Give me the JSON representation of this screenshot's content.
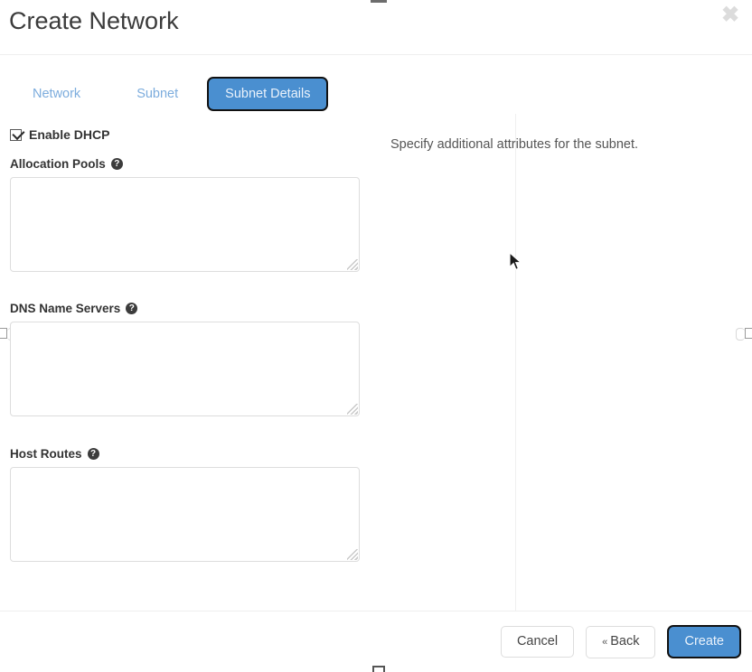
{
  "modal": {
    "title": "Create Network",
    "close_icon": "close-icon",
    "close_glyph": "✖"
  },
  "tabs": [
    {
      "label": "Network",
      "active": false
    },
    {
      "label": "Subnet",
      "active": false
    },
    {
      "label": "Subnet Details",
      "active": true
    }
  ],
  "form": {
    "dhcp": {
      "label": "Enable DHCP",
      "checked": true
    },
    "fields": [
      {
        "label": "Allocation Pools",
        "help_icon": "help-circle-icon",
        "help_glyph": "?",
        "value": "",
        "placeholder": ""
      },
      {
        "label": "DNS Name Servers",
        "help_icon": "help-circle-icon",
        "help_glyph": "?",
        "value": "",
        "placeholder": ""
      },
      {
        "label": "Host Routes",
        "help_icon": "help-circle-icon",
        "help_glyph": "?",
        "value": "",
        "placeholder": ""
      }
    ]
  },
  "side_panel": {
    "helper_text": "Specify additional attributes for the subnet."
  },
  "footer": {
    "cancel_label": "Cancel",
    "back_chevron": "«",
    "back_label": "Back",
    "create_label": "Create"
  },
  "colors": {
    "accent_blue": "#4a8fd0",
    "tab_link_blue": "#7cacdd",
    "focus_ring": "#111111",
    "border_gray": "#dddddd",
    "title_text": "#3b3b3b",
    "label_text": "#333333",
    "helper_text": "#555555"
  }
}
